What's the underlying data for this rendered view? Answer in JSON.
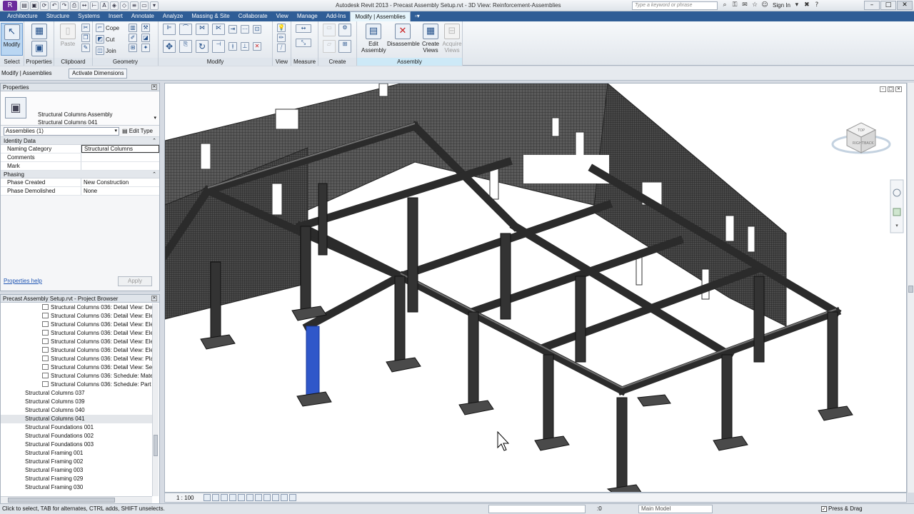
{
  "window": {
    "title": "Autodesk Revit 2013 -    Precast Assembly Setup.rvt - 3D View: Reinforcement-Assemblies",
    "search_placeholder": "Type a keyword or phrase",
    "sign_in": "Sign In"
  },
  "tabs": [
    "Architecture",
    "Structure",
    "Systems",
    "Insert",
    "Annotate",
    "Analyze",
    "Massing & Site",
    "Collaborate",
    "View",
    "Manage",
    "Add-Ins"
  ],
  "active_tab": "Modify | Assemblies",
  "ribbon": {
    "select": {
      "modify": "Modify",
      "title": "Select"
    },
    "properties": {
      "title": "Properties"
    },
    "clipboard": {
      "paste": "Paste",
      "title": "Clipboard"
    },
    "geometry": {
      "cope": "Cope",
      "cut": "Cut",
      "join": "Join",
      "title": "Geometry"
    },
    "modify": {
      "title": "Modify"
    },
    "view": {
      "title": "View"
    },
    "measure": {
      "title": "Measure"
    },
    "create": {
      "title": "Create"
    },
    "assembly": {
      "edit": "Edit Assembly",
      "disassemble": "Disassemble",
      "create_views": "Create Views",
      "acquire_views": "Acquire Views",
      "title": "Assembly"
    }
  },
  "options_bar": {
    "context": "Modify | Assemblies",
    "activate_dimensions": "Activate Dimensions"
  },
  "properties": {
    "title": "Properties",
    "type_line1": "Structural Columns Assembly",
    "type_line2": "Structural Columns 041",
    "instance": "Assemblies (1)",
    "edit_type": "Edit Type",
    "groups": [
      {
        "name": "Identity Data",
        "rows": [
          {
            "k": "Naming Category",
            "v": "Structural Columns"
          },
          {
            "k": "Comments",
            "v": ""
          },
          {
            "k": "Mark",
            "v": ""
          }
        ]
      },
      {
        "name": "Phasing",
        "rows": [
          {
            "k": "Phase Created",
            "v": "New Construction"
          },
          {
            "k": "Phase Demolished",
            "v": "None"
          }
        ]
      }
    ],
    "help": "Properties help",
    "apply": "Apply"
  },
  "browser": {
    "title": "Precast Assembly Setup.rvt - Project Browser",
    "items": [
      {
        "t": "Structural Columns 036: Detail View: De",
        "indent": 2
      },
      {
        "t": "Structural Columns 036: Detail View: Ele",
        "indent": 2
      },
      {
        "t": "Structural Columns 036: Detail View: Ele",
        "indent": 2
      },
      {
        "t": "Structural Columns 036: Detail View: Ele",
        "indent": 2
      },
      {
        "t": "Structural Columns 036: Detail View: Ele",
        "indent": 2
      },
      {
        "t": "Structural Columns 036: Detail View: Ele",
        "indent": 2
      },
      {
        "t": "Structural Columns 036: Detail View: Pla",
        "indent": 2
      },
      {
        "t": "Structural Columns 036: Detail View: Sec",
        "indent": 2
      },
      {
        "t": "Structural Columns 036: Schedule: Mate",
        "indent": 2
      },
      {
        "t": "Structural Columns 036: Schedule: Part l",
        "indent": 2
      },
      {
        "t": "Structural Columns 037",
        "indent": 1
      },
      {
        "t": "Structural Columns 039",
        "indent": 1
      },
      {
        "t": "Structural Columns 040",
        "indent": 1
      },
      {
        "t": "Structural Columns 041",
        "indent": 1,
        "sel": true
      },
      {
        "t": "Structural Foundations 001",
        "indent": 1
      },
      {
        "t": "Structural Foundations 002",
        "indent": 1
      },
      {
        "t": "Structural Foundations 003",
        "indent": 1
      },
      {
        "t": "Structural Framing 001",
        "indent": 1
      },
      {
        "t": "Structural Framing 002",
        "indent": 1
      },
      {
        "t": "Structural Framing 003",
        "indent": 1
      },
      {
        "t": "Structural Framing 029",
        "indent": 1
      },
      {
        "t": "Structural Framing 030",
        "indent": 1
      }
    ]
  },
  "viewcube": {
    "right": "RIGHT",
    "back": "BACK",
    "top": "TOP"
  },
  "view_bar": {
    "scale": "1 : 100"
  },
  "status": {
    "message": "Click to select, TAB for alternates, CTRL adds, SHIFT unselects.",
    "count": ":0",
    "model": "Main Model",
    "press_drag": "Press & Drag"
  },
  "colors": {
    "tab_bar": "#2f5d96",
    "contextual_tab": "#7ecbf4",
    "selection": "#2f57c9",
    "frame": "#3a3a3a"
  }
}
